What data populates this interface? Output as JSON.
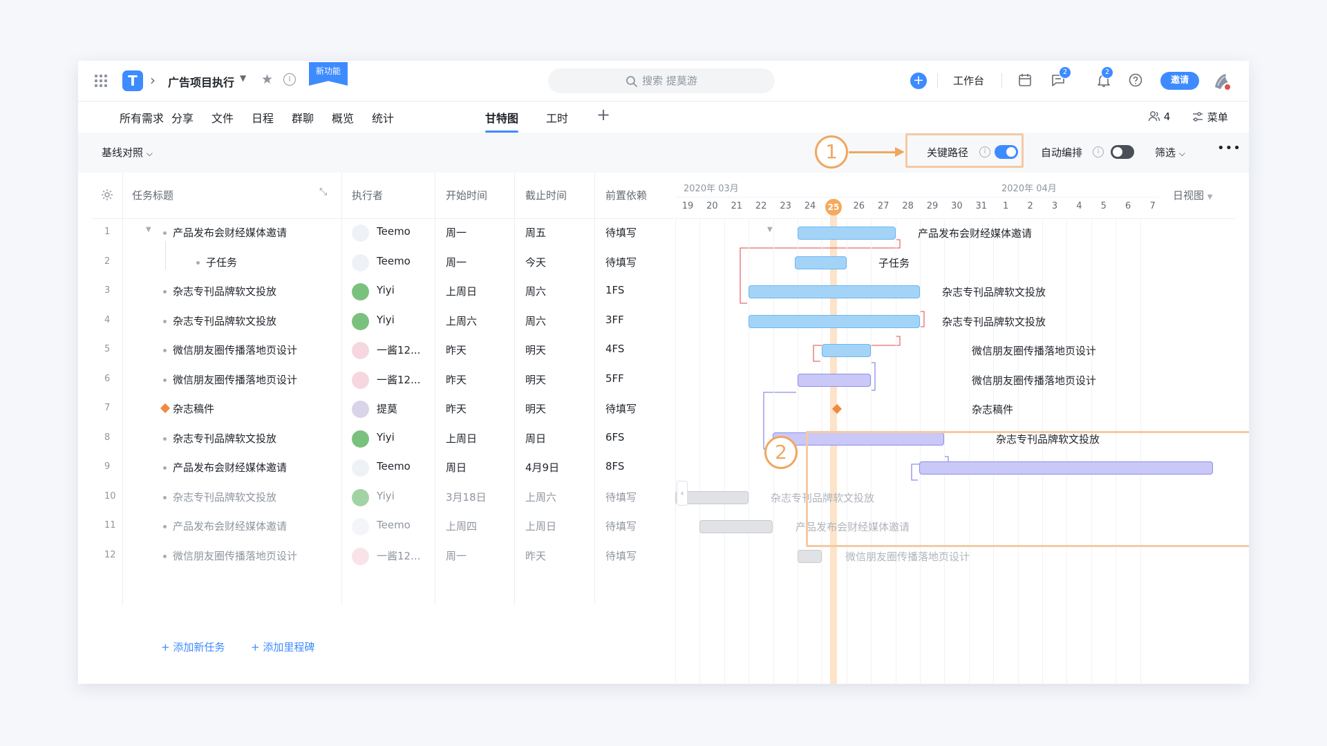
{
  "header": {
    "project_title": "广告项目执行",
    "new_badge": "新功能",
    "search_placeholder": "搜索 提莫游",
    "workbench": "工作台",
    "chat_badge": "2",
    "notify_badge": "2",
    "invite": "邀请",
    "logo_letter": "T"
  },
  "tabs": [
    {
      "label": "所有需求"
    },
    {
      "label": "分享"
    },
    {
      "label": "文件"
    },
    {
      "label": "日程"
    },
    {
      "label": "群聊"
    },
    {
      "label": "概览"
    },
    {
      "label": "统计"
    },
    {
      "label": "甘特图",
      "active": true
    },
    {
      "label": "工时"
    }
  ],
  "nav_right": {
    "member_count": "4",
    "menu": "菜单"
  },
  "toolbar": {
    "baseline": "基线对照",
    "critical_path": "关键路径",
    "critical_path_on": true,
    "auto_schedule": "自动编排",
    "auto_schedule_on": false,
    "filter": "筛选"
  },
  "callouts": [
    "1",
    "2"
  ],
  "table": {
    "headers": [
      "任务标题",
      "执行者",
      "开始时间",
      "截止时间",
      "前置依赖"
    ],
    "rows": [
      {
        "n": "1",
        "title": "产品发布会财经媒体邀请",
        "assignee": "Teemo",
        "start": "周一",
        "end": "周五",
        "dep": "待填写",
        "kind": "parent"
      },
      {
        "n": "2",
        "title": "子任务",
        "assignee": "Teemo",
        "start": "周一",
        "end": "今天",
        "dep": "待填写",
        "kind": "child"
      },
      {
        "n": "3",
        "title": "杂志专刊品牌软文投放",
        "assignee": "Yiyi",
        "start": "上周日",
        "end": "周六",
        "dep": "1FS",
        "kind": "task"
      },
      {
        "n": "4",
        "title": "杂志专刊品牌软文投放",
        "assignee": "Yiyi",
        "start": "上周六",
        "end": "周六",
        "dep": "3FF",
        "kind": "task"
      },
      {
        "n": "5",
        "title": "微信朋友圈传播落地页设计",
        "assignee": "一酱12...",
        "start": "昨天",
        "end": "明天",
        "dep": "4FS",
        "kind": "task"
      },
      {
        "n": "6",
        "title": "微信朋友圈传播落地页设计",
        "assignee": "一酱12...",
        "start": "昨天",
        "end": "明天",
        "dep": "5FF",
        "kind": "task"
      },
      {
        "n": "7",
        "title": "杂志稿件",
        "assignee": "提莫",
        "start": "昨天",
        "end": "明天",
        "dep": "待填写",
        "kind": "milestone"
      },
      {
        "n": "8",
        "title": "杂志专刊品牌软文投放",
        "assignee": "Yiyi",
        "start": "上周日",
        "end": "周日",
        "dep": "6FS",
        "kind": "task"
      },
      {
        "n": "9",
        "title": "产品发布会财经媒体邀请",
        "assignee": "Teemo",
        "start": "周日",
        "end": "4月9日",
        "dep": "8FS",
        "kind": "task"
      },
      {
        "n": "10",
        "title": "杂志专刊品牌软文投放",
        "assignee": "Yiyi",
        "start": "3月18日",
        "end": "上周六",
        "dep": "待填写",
        "kind": "done"
      },
      {
        "n": "11",
        "title": "产品发布会财经媒体邀请",
        "assignee": "Teemo",
        "start": "上周四",
        "end": "上周日",
        "dep": "待填写",
        "kind": "done"
      },
      {
        "n": "12",
        "title": "微信朋友圈传播落地页设计",
        "assignee": "一酱12...",
        "start": "周一",
        "end": "昨天",
        "dep": "待填写",
        "kind": "done"
      }
    ],
    "add_task": "+ 添加新任务",
    "add_milestone": "+ 添加里程碑"
  },
  "gantt": {
    "month_march": "2020年 03月",
    "month_april": "2020年 04月",
    "days": [
      "19",
      "20",
      "21",
      "22",
      "23",
      "24",
      "25",
      "26",
      "27",
      "28",
      "29",
      "30",
      "31",
      "1",
      "2",
      "3",
      "4",
      "5",
      "6",
      "7"
    ],
    "today": "25",
    "view": "日视图",
    "bar_labels": [
      "产品发布会财经媒体邀请",
      "子任务",
      "杂志专刊品牌软文投放",
      "杂志专刊品牌软文投放",
      "微信朋友圈传播落地页设计",
      "微信朋友圈传播落地页设计",
      "杂志稿件",
      "杂志专刊品牌软文投放",
      "",
      "杂志专刊品牌软文投放",
      "产品发布会财经媒体邀请",
      "微信朋友圈传播落地页设计"
    ],
    "colors": {
      "blue": "#a3d4f8",
      "purple": "#c9c8f7",
      "gray": "#e1e2e5",
      "accent": "#3d8bff",
      "milestone": "#f08a3e",
      "highlight": "#f5c9a2"
    }
  }
}
